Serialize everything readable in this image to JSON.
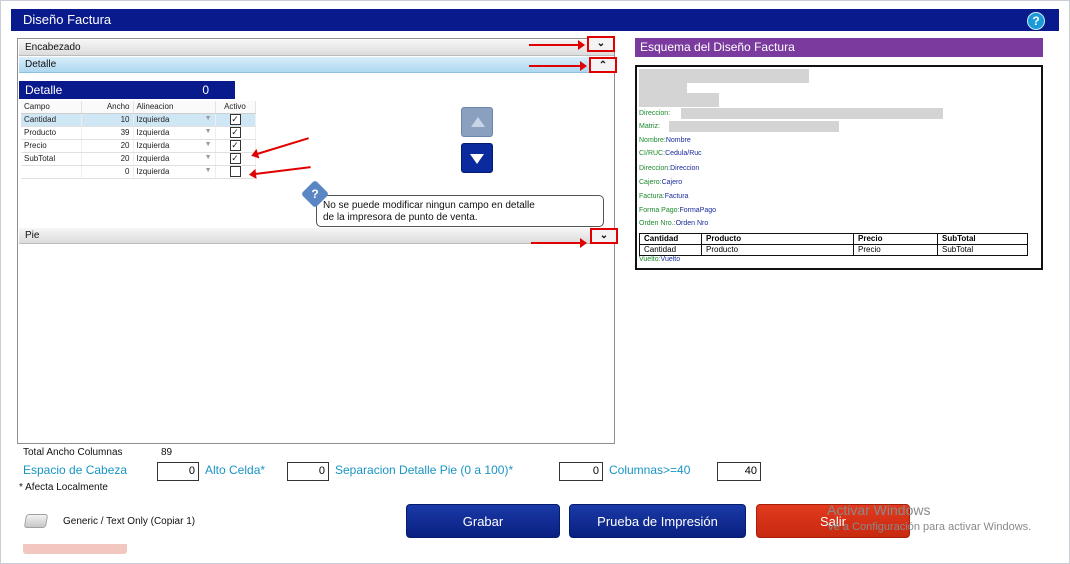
{
  "window": {
    "title": "Diseño Factura",
    "help_label": "?"
  },
  "sections": {
    "encabezado": "Encabezado",
    "detalle": "Detalle",
    "pie": "Pie",
    "collapsed_glyph": "⌄",
    "expanded_glyph": "⌃"
  },
  "detalle": {
    "title": "Detalle",
    "count": "0",
    "columns": [
      "Campo",
      "Ancho",
      "Alineacion",
      "Activo"
    ],
    "rows": [
      {
        "campo": "Cantidad",
        "ancho": "10",
        "alineacion": "Izquierda",
        "activo": true
      },
      {
        "campo": "Producto",
        "ancho": "39",
        "alineacion": "Izquierda",
        "activo": true
      },
      {
        "campo": "Precio",
        "ancho": "20",
        "alineacion": "Izquierda",
        "activo": true
      },
      {
        "campo": "SubTotal",
        "ancho": "20",
        "alineacion": "Izquierda",
        "activo": true
      },
      {
        "campo": "",
        "ancho": "0",
        "alineacion": "Izquierda",
        "activo": false
      }
    ]
  },
  "tooltip": {
    "icon": "?",
    "line1": "No se puede modificar ningun campo en detalle",
    "line2": "de la impresora de punto de venta."
  },
  "preview": {
    "title": "Esquema del Diseño Factura",
    "lines": [
      {
        "label": "Direccion:",
        "value": ""
      },
      {
        "label": "Matriz:",
        "value": ""
      },
      {
        "label": "Nombre:",
        "value": "Nombre"
      },
      {
        "label": "CI/RUC:",
        "value": "Cedula/Ruc"
      },
      {
        "label": "Direccion:",
        "value": "Direccion"
      },
      {
        "label": "Cajero:",
        "value": "Cajero"
      },
      {
        "label": "Factura:",
        "value": "Factura"
      },
      {
        "label": "Forma Pago:",
        "value": "FormaPago"
      },
      {
        "label": "Orden Nro.:",
        "value": "Orden Nro"
      }
    ],
    "table_headers": [
      "Cantidad",
      "Producto",
      "Precio",
      "SubTotal"
    ],
    "table_values": [
      "Cantidad",
      "Producto",
      "Precio",
      "SubTotal"
    ],
    "vuelto_label": "Vuelto:",
    "vuelto_value": "Vuelto"
  },
  "footer": {
    "total_label": "Total Ancho Columnas",
    "total_value": "89",
    "espacio_label": "Espacio de Cabeza",
    "espacio_value": "0",
    "alto_label": "Alto Celda*",
    "alto_value": "0",
    "separacion_label": "Separacion Detalle Pie (0 a 100)*",
    "separacion_value": "0",
    "columnas_label": "Columnas>=40",
    "columnas_value": "40",
    "note": "* Afecta Localmente",
    "printer": "Generic / Text Only (Copiar 1)"
  },
  "buttons": {
    "grabar": "Grabar",
    "prueba": "Prueba de Impresión",
    "salir": "Salir"
  },
  "watermark": {
    "line1": "Activar Windows",
    "line2": "Ve a Configuración para activar Windows."
  },
  "colors": {
    "title_bar": "#081a8c",
    "preview_header": "#7a3a9e",
    "accent_label": "#1895c4",
    "annotation": "#e00000",
    "salir_button": "#d6341a"
  }
}
